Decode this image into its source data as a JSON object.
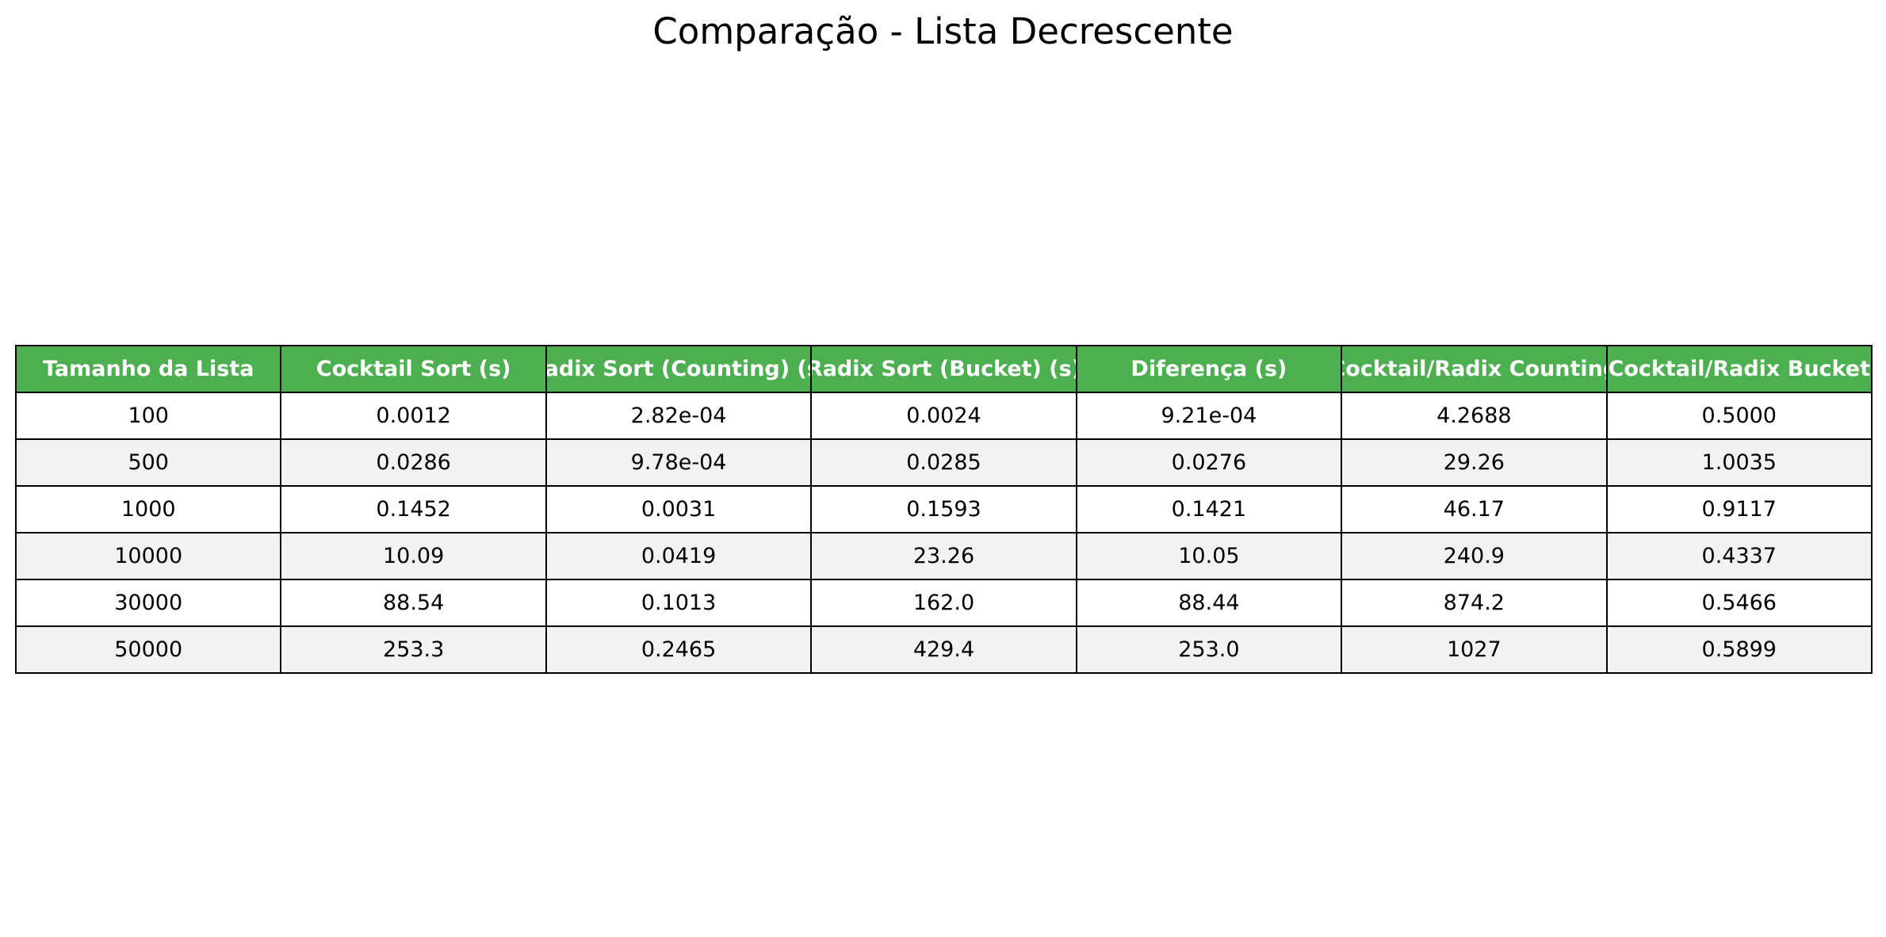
{
  "chart_data": {
    "type": "table",
    "title": "Comparação - Lista Decrescente",
    "header_color": "#4caf50",
    "header_text_color": "#ffffff",
    "stripe_color": "#f2f2f2",
    "columns": [
      "Tamanho da Lista",
      "Cocktail Sort (s)",
      "Radix Sort (Counting) (s)",
      "Radix Sort (Bucket) (s)",
      "Diferença (s)",
      "Cocktail/Radix Counting",
      "Cocktail/Radix Bucket"
    ],
    "rows": [
      [
        "100",
        "0.0012",
        "2.82e-04",
        "0.0024",
        "9.21e-04",
        "4.2688",
        "0.5000"
      ],
      [
        "500",
        "0.0286",
        "9.78e-04",
        "0.0285",
        "0.0276",
        "29.26",
        "1.0035"
      ],
      [
        "1000",
        "0.1452",
        "0.0031",
        "0.1593",
        "0.1421",
        "46.17",
        "0.9117"
      ],
      [
        "10000",
        "10.09",
        "0.0419",
        "23.26",
        "10.05",
        "240.9",
        "0.4337"
      ],
      [
        "30000",
        "88.54",
        "0.1013",
        "162.0",
        "88.44",
        "874.2",
        "0.5466"
      ],
      [
        "50000",
        "253.3",
        "0.2465",
        "429.4",
        "253.0",
        "1027",
        "0.5899"
      ]
    ]
  }
}
